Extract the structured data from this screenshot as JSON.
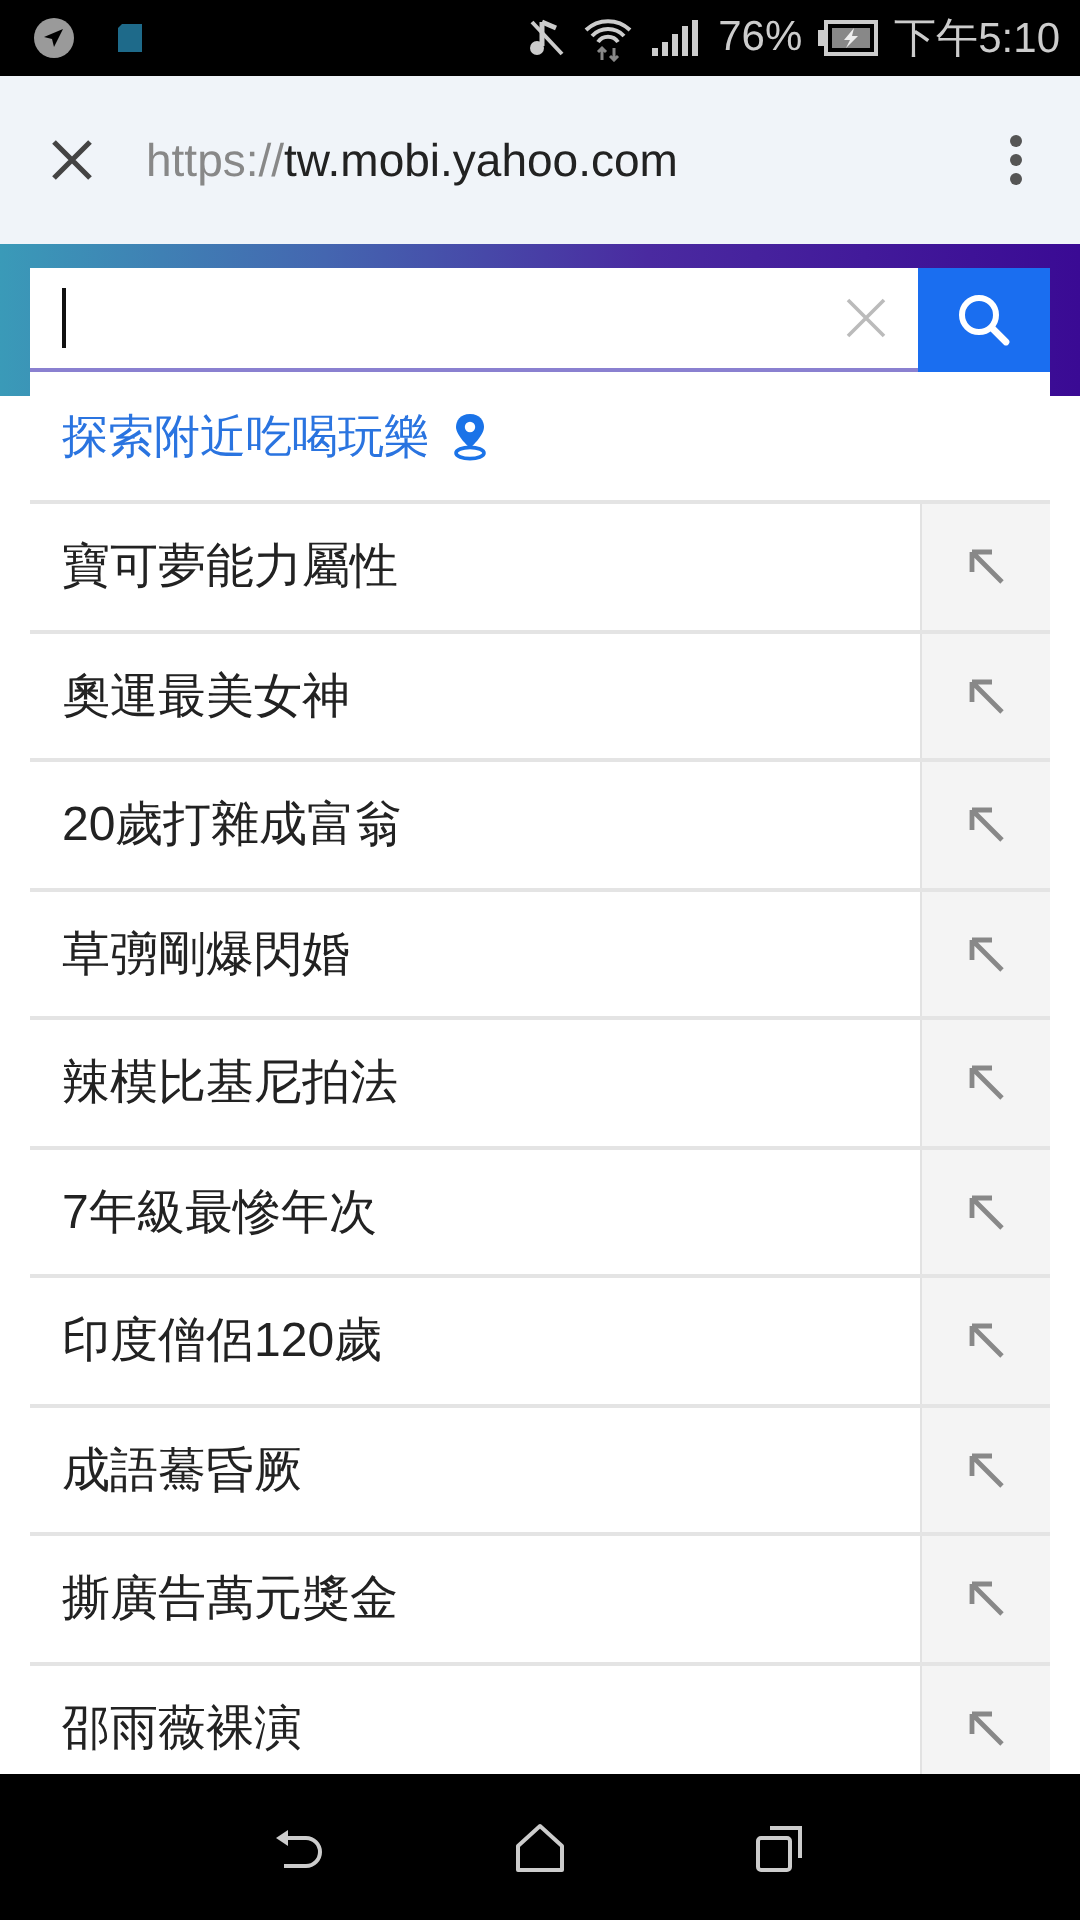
{
  "status_bar": {
    "battery": "76%",
    "time": "下午5:10"
  },
  "browser_bar": {
    "url_scheme": "https://",
    "url_host": "tw.mobi.yahoo.com"
  },
  "search": {
    "focused": true
  },
  "nearby_link": "探索附近吃喝玩樂",
  "suggestions": [
    {
      "text": "寶可夢能力屬性"
    },
    {
      "text": "奧運最美女神"
    },
    {
      "text": "20歲打雜成富翁"
    },
    {
      "text": "草彅剛爆閃婚"
    },
    {
      "text": "辣模比基尼拍法"
    },
    {
      "text": "7年級最慘年次"
    },
    {
      "text": "印度僧侶120歲"
    },
    {
      "text": "成語驀昏厥"
    },
    {
      "text": "撕廣告萬元獎金"
    },
    {
      "text": "邵雨薇裸演"
    }
  ]
}
